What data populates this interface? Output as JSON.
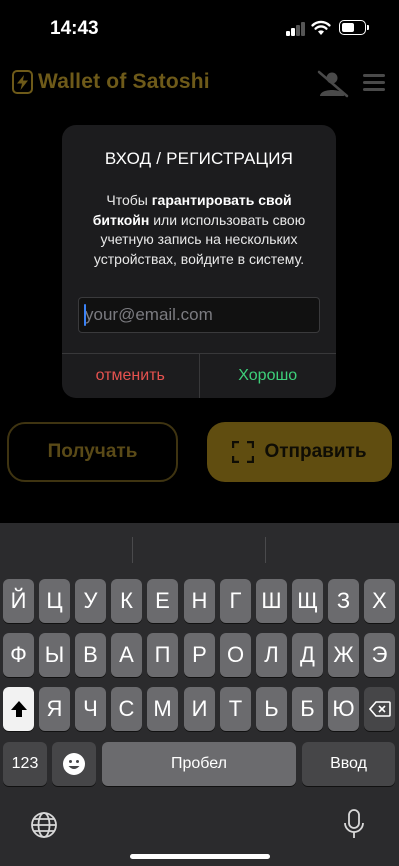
{
  "status_bar": {
    "time": "14:43"
  },
  "app": {
    "title": "Wallet of Satoshi"
  },
  "main": {
    "receive_label": "Получать",
    "send_label": "Отправить"
  },
  "dialog": {
    "title": "ВХОД / РЕГИСТРАЦИЯ",
    "message_prefix": "Чтобы ",
    "message_bold": "гарантировать свой биткойн",
    "message_suffix": " или использовать свою учетную запись на нескольких устройствах, войдите в систему.",
    "email_placeholder": "your@email.com",
    "email_value": "",
    "cancel_label": "отменить",
    "ok_label": "Хорошо"
  },
  "keyboard": {
    "row1": [
      "Й",
      "Ц",
      "У",
      "К",
      "Е",
      "Н",
      "Г",
      "Ш",
      "Щ",
      "З",
      "Х"
    ],
    "row2": [
      "Ф",
      "Ы",
      "В",
      "А",
      "П",
      "Р",
      "О",
      "Л",
      "Д",
      "Ж",
      "Э"
    ],
    "row3": [
      "Я",
      "Ч",
      "С",
      "М",
      "И",
      "Т",
      "Ь",
      "Б",
      "Ю"
    ],
    "numbers_key": "123",
    "space_key": "Пробел",
    "return_key": "Ввод"
  },
  "colors": {
    "accent_gold": "#f7c21c",
    "cancel_red": "#e5524f",
    "ok_green": "#3dd07a"
  }
}
